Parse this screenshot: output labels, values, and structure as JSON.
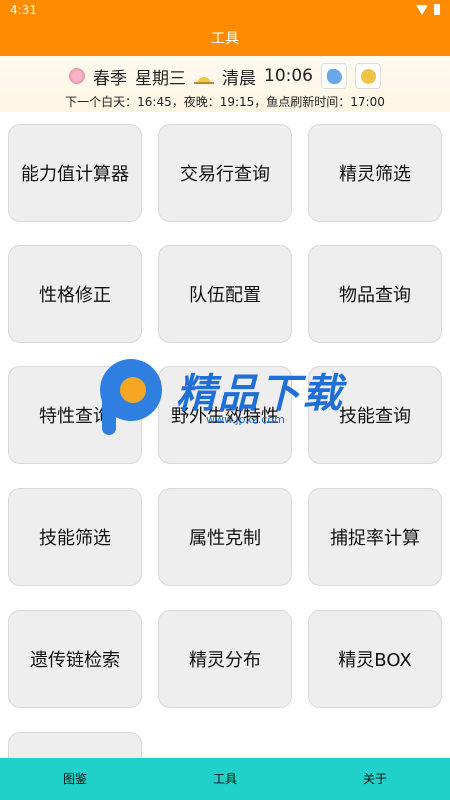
{
  "status_bar": {
    "time": "4:31"
  },
  "app_bar": {
    "title": "工具"
  },
  "info": {
    "season": "春季",
    "weekday": "星期三",
    "period": "清晨",
    "clock": "10:06",
    "schedule": "下一个白天：16:45，夜晚：19:15，鱼点刷新时间：17:00"
  },
  "tools": [
    "能力值计算器",
    "交易行查询",
    "精灵筛选",
    "性格修正",
    "队伍配置",
    "物品查询",
    "特性查询",
    "野外生效特性",
    "技能查询",
    "技能筛选",
    "属性克制",
    "捕捉率计算",
    "遗传链检索",
    "精灵分布",
    "精灵BOX",
    ""
  ],
  "watermark": {
    "brand": "精品下载",
    "url": "www.jpxz.com"
  },
  "bottom_nav": {
    "tab1": "图鉴",
    "tab2": "工具",
    "tab3": "关于"
  },
  "colors": {
    "primary": "#ff8c00",
    "nav": "#1fd1c8",
    "tile": "#eeeeee"
  }
}
